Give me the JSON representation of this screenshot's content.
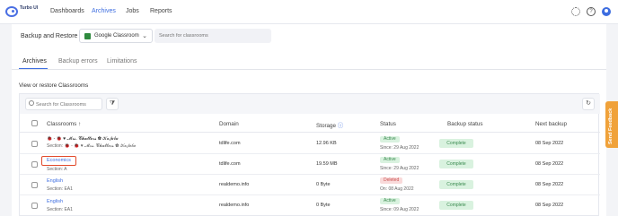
{
  "app": {
    "logo_text": "Turbo UI"
  },
  "nav": {
    "items": [
      "Dashboards",
      "Archives",
      "Jobs",
      "Reports"
    ],
    "active": "Archives"
  },
  "header": {
    "title": "Backup and Restore",
    "source_select": "Google Classroom",
    "search_placeholder": "Search for classrooms"
  },
  "tabs": [
    "Archives",
    "Backup errors",
    "Limitations"
  ],
  "section_title": "View or restore Classrooms",
  "table": {
    "search_placeholder": "Search for Classrooms",
    "columns": [
      "Classrooms",
      "Domain",
      "Storage",
      "Status",
      "Backup status",
      "Next backup"
    ],
    "rows": [
      {
        "name": "🐞 - 🐞 ♥ 𝓜𝓻𝓼. 𝓒𝓱𝓪𝓽𝓽𝓮𝓻𝓼 ✿ 𝒦𝒶𝒻𝓊𝒷𝓊",
        "section": "Section: 🐞 - 🐞 ♥ 𝓜𝓻𝓼. 𝓒𝓱𝓪𝓽𝓽𝓮𝓻𝓼 ✿ 𝒦𝒶𝒻𝓊𝒷𝓊",
        "domain": "tdlife.com",
        "storage": "12.96 KB",
        "status": "Active",
        "status_date": "Since: 29 Aug 2022",
        "backup_status": "Complete",
        "next_backup": "08 Sep 2022"
      },
      {
        "name": "Economics",
        "section": "Section: A",
        "domain": "tdlife.com",
        "storage": "19.59 MB",
        "status": "Active",
        "status_date": "Since: 29 Aug 2022",
        "backup_status": "Complete",
        "next_backup": "08 Sep 2022"
      },
      {
        "name": "English",
        "section": "Section: EA1",
        "domain": "realdemo.info",
        "storage": "0 Byte",
        "status": "Deleted",
        "status_date": "On: 08 Aug 2022",
        "backup_status": "Complete",
        "next_backup": "08 Sep 2022"
      },
      {
        "name": "English",
        "section": "Section: EA1",
        "domain": "realdemo.info",
        "storage": "0 Byte",
        "status": "Active",
        "status_date": "Since: 09 Aug 2022",
        "backup_status": "Complete",
        "next_backup": "08 Sep 2022"
      }
    ]
  },
  "feedback": "Send Feedback",
  "colors": {
    "accent": "#3d6de0",
    "active_badge": "#d9f2df",
    "deleted_badge": "#f9dada",
    "feedback": "#f0a23a"
  }
}
